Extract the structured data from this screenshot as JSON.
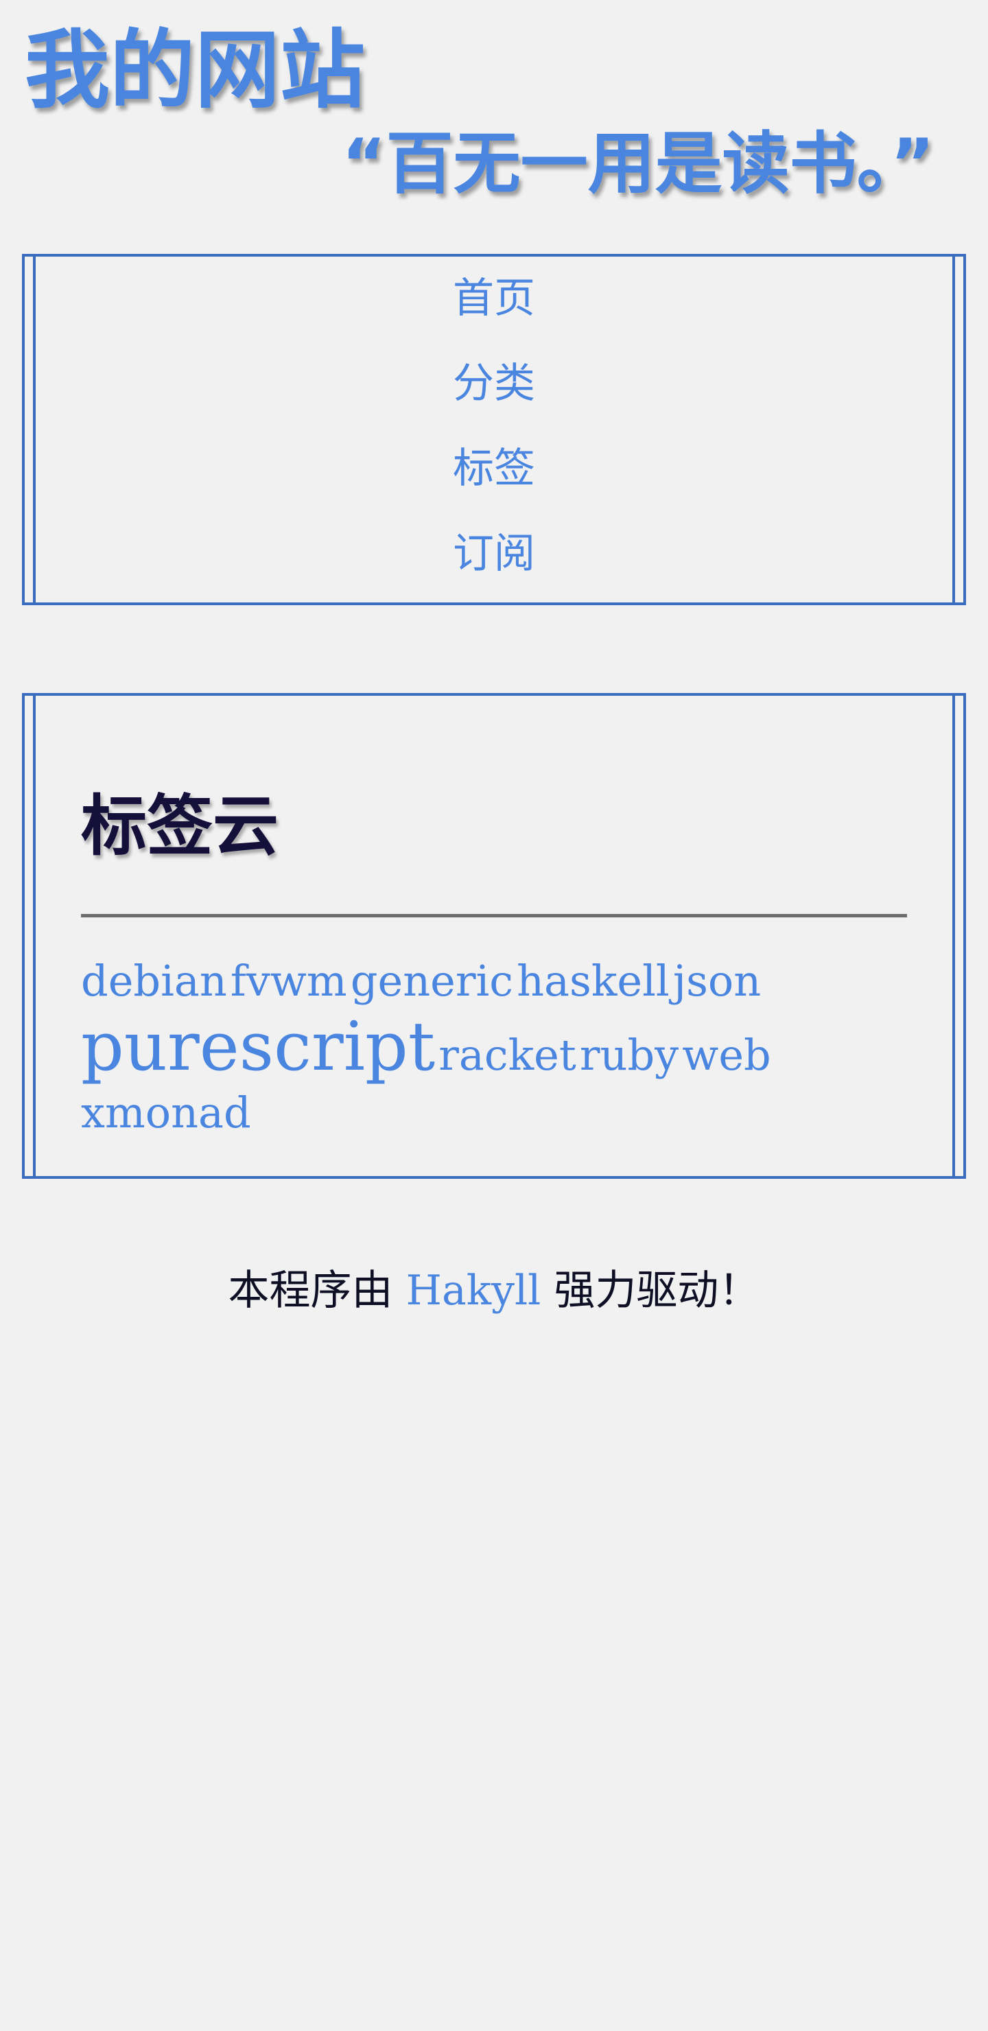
{
  "header": {
    "site_title": "我的网站",
    "motto": "“百无一用是读书。”"
  },
  "nav": {
    "items": [
      {
        "label": "首页"
      },
      {
        "label": "分类"
      },
      {
        "label": "标签"
      },
      {
        "label": "订阅"
      }
    ]
  },
  "tag_cloud": {
    "title": "标签云",
    "tags": [
      {
        "label": "debian",
        "size": "small"
      },
      {
        "label": "fvwm",
        "size": "small"
      },
      {
        "label": "generic",
        "size": "small"
      },
      {
        "label": "haskell",
        "size": "small"
      },
      {
        "label": "json",
        "size": "small"
      },
      {
        "label": "purescript",
        "size": "large"
      },
      {
        "label": "racket",
        "size": "small"
      },
      {
        "label": "ruby",
        "size": "small"
      },
      {
        "label": "web",
        "size": "small"
      },
      {
        "label": "xmonad",
        "size": "small"
      }
    ]
  },
  "footer": {
    "prefix": "本程序由",
    "link_label": "Hakyll",
    "suffix": "强力驱动！"
  },
  "colors": {
    "background": "#f1f1f1",
    "accent": "#4a86e0",
    "frame_border": "#3a6dbd",
    "heading_text": "#14103a"
  }
}
